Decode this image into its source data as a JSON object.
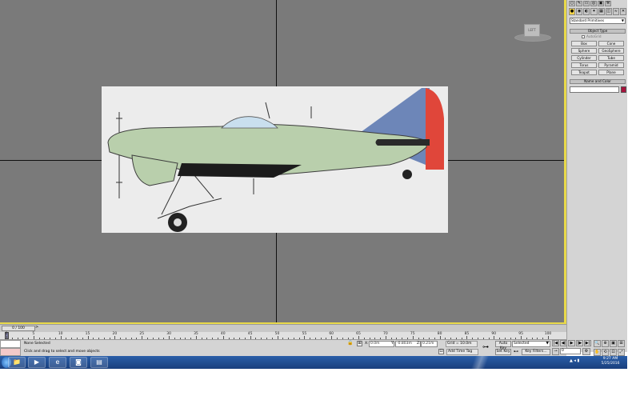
{
  "viewport": {
    "viewcube_label": "LEFT"
  },
  "command_panel": {
    "icons": [
      "○",
      "✎",
      "▭",
      "◎",
      "▣",
      "⚒"
    ],
    "tabs": [
      "●",
      "◉",
      "◐",
      "✦",
      "▦",
      "◫",
      "≈",
      "✕"
    ],
    "dropdown_value": "Standard Primitives",
    "object_type_header": "Object Type",
    "autogrid_label": "AutoGrid",
    "object_buttons": [
      "Box",
      "Cone",
      "Sphere",
      "GeoSphere",
      "Cylinder",
      "Tube",
      "Torus",
      "Pyramid",
      "Teapot",
      "Plane"
    ],
    "name_color_header": "Name and Color",
    "name_value": "",
    "color": "#a8123c"
  },
  "timeline": {
    "frame_display": "0 / 100",
    "next_label": ">",
    "tick_labels": [
      "0",
      "5",
      "10",
      "15",
      "20",
      "25",
      "30",
      "35",
      "40",
      "45",
      "50",
      "55",
      "60",
      "65",
      "70",
      "75",
      "80",
      "85",
      "90",
      "95",
      "100"
    ]
  },
  "status": {
    "selection": "None Selected",
    "prompt": "Click and drag to select and move objects",
    "x_label": "X:",
    "x_value": "0.0m",
    "y_label": "Y:",
    "y_value": "-0.803m",
    "z_label": "Z:",
    "z_value": "0.21m",
    "grid": "Grid = 10.0m",
    "add_time_tag": "Add Time Tag",
    "auto_key": "Auto Key",
    "set_key": "Set Key",
    "selected_dropdown": "Selected",
    "key_filters": "Key Filters...",
    "frame_value": "0"
  },
  "playback": [
    "|◀",
    "◀|",
    "▶",
    "|▶",
    "▶|"
  ],
  "nav": [
    "🔍",
    "⊕",
    "▣",
    "⊞",
    "✋",
    "⟲",
    "⊡",
    "⤢"
  ],
  "taskbar": {
    "apps": [
      "📁",
      "▶",
      "e",
      "◙",
      "▤"
    ],
    "tray": "▲ ◂ ▮",
    "time": "9:27 AM",
    "date": "5/25/2016"
  }
}
